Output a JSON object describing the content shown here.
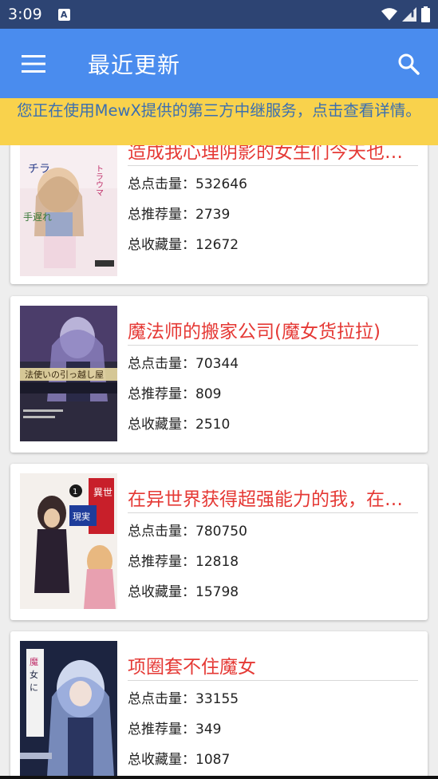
{
  "status": {
    "time": "3:09",
    "notification_letter": "A"
  },
  "app_bar": {
    "title": "最近更新"
  },
  "banner": {
    "text": "您正在使用MewX提供的第三方中继服务，点击查看详情。"
  },
  "labels": {
    "clicks": "总点击量：",
    "recommends": "总推荐量：",
    "favorites": "总收藏量："
  },
  "books": [
    {
      "title": "造成我心理阴影的女生们今天也…",
      "clicks": "532646",
      "recommends": "2739",
      "favorites": "12672"
    },
    {
      "title": "魔法师的搬家公司(魔女货拉拉)",
      "clicks": "70344",
      "recommends": "809",
      "favorites": "2510"
    },
    {
      "title": "在异世界获得超强能力的我，在…",
      "clicks": "780750",
      "recommends": "12818",
      "favorites": "15798"
    },
    {
      "title": "项圈套不住魔女",
      "clicks": "33155",
      "recommends": "349",
      "favorites": "1087"
    }
  ],
  "colors": {
    "status_bar": "#2d4473",
    "app_bar": "#4a8cee",
    "banner": "#f9d24c",
    "banner_text": "#3b6fb0",
    "title_red": "#e53935"
  }
}
